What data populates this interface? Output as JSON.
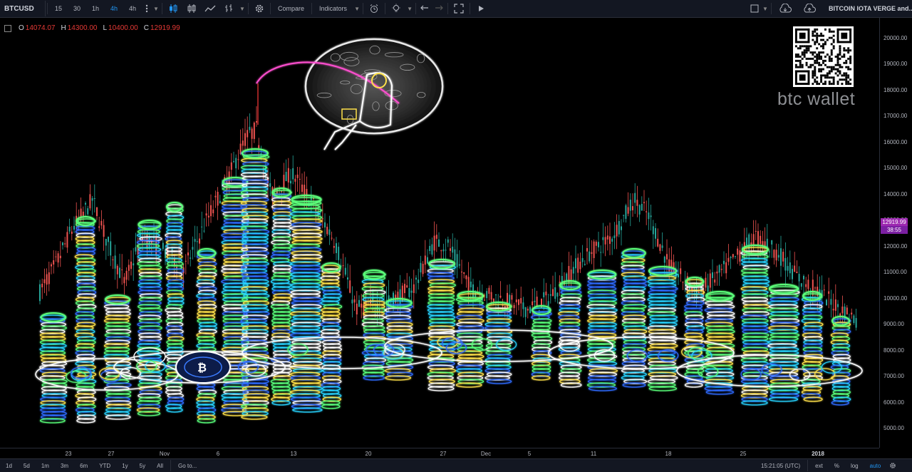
{
  "toolbar": {
    "symbol": "BTCUSD",
    "intervals": [
      "15",
      "30",
      "1h",
      "4h",
      "4h"
    ],
    "active_interval_index": 3,
    "compare_label": "Compare",
    "indicators_label": "Indicators",
    "layout_name": "BITCOIN IOTA VERGE and..."
  },
  "ohlc": {
    "o_label": "O",
    "o_value": "14074.07",
    "h_label": "H",
    "h_value": "14300.00",
    "l_label": "L",
    "l_value": "10400.00",
    "c_label": "C",
    "c_value": "12919.99"
  },
  "overlay": {
    "wallet_text": "btc wallet",
    "accent_color": "#9c27b0"
  },
  "price_axis": {
    "ticks": [
      "20000.00",
      "19000.00",
      "18000.00",
      "17000.00",
      "16000.00",
      "15000.00",
      "14000.00",
      "13000.00",
      "12000.00",
      "11000.00",
      "10000.00",
      "9000.00",
      "8000.00",
      "7000.00",
      "6000.00",
      "5000.00"
    ],
    "current_price": "12919.99",
    "countdown": "38:55"
  },
  "time_axis": {
    "ticks": [
      "23",
      "27",
      "Nov",
      "6",
      "13",
      "20",
      "27",
      "Dec",
      "5",
      "11",
      "18",
      "25",
      "2018"
    ]
  },
  "bottom_bar": {
    "ranges": [
      "1d",
      "5d",
      "1m",
      "3m",
      "6m",
      "YTD",
      "1y",
      "5y",
      "All"
    ],
    "goto_label": "Go to...",
    "clock": "15:21:05 (UTC)",
    "ext_label": "ext",
    "percent_label": "%",
    "log_label": "log",
    "auto_label": "auto"
  },
  "chart_data": {
    "type": "candlestick",
    "ylim": [
      4600,
      20400
    ],
    "current_price": 12919.99,
    "price_axis_position": "right",
    "x_ticks": [
      "23",
      "27",
      "Nov",
      "6",
      "13",
      "20",
      "27",
      "Dec",
      "5",
      "11",
      "18",
      "25",
      "2018"
    ],
    "up_color": "#26a69a",
    "down_color": "#ef5350"
  }
}
